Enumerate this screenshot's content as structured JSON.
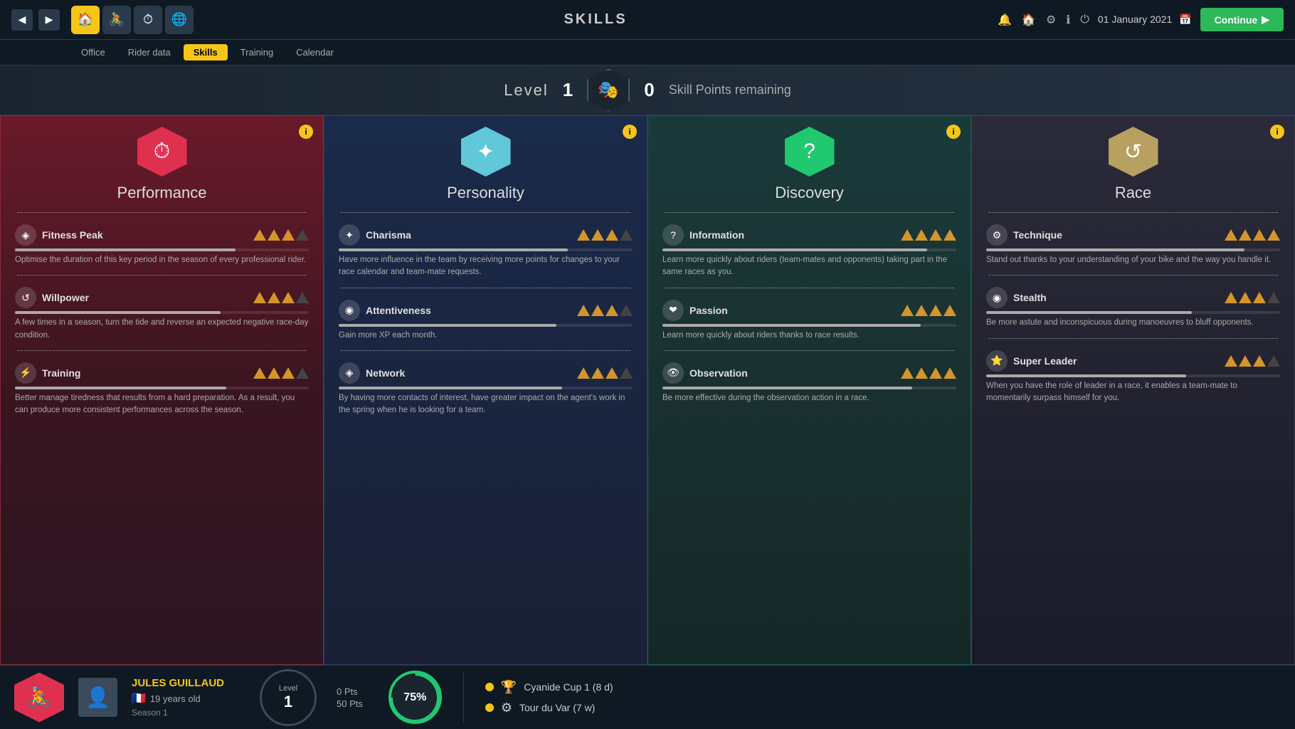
{
  "topBar": {
    "title": "SKILLS",
    "date": "01 January 2021",
    "continueLabel": "Continue"
  },
  "subNav": {
    "tabs": [
      "Office",
      "Rider data",
      "Skills",
      "Training",
      "Calendar"
    ],
    "activeTab": "Skills"
  },
  "levelBar": {
    "levelLabel": "Level",
    "levelNum": "1",
    "skillPointsNum": "0",
    "skillPointsLabel": "Skill Points remaining"
  },
  "cards": [
    {
      "id": "performance",
      "title": "Performance",
      "iconColor": "red",
      "iconSymbol": "⏱",
      "skills": [
        {
          "name": "Fitness Peak",
          "stars": 3,
          "maxStars": 4,
          "barPct": 75,
          "desc": "Optimise the duration of this key period in the season of every professional rider."
        },
        {
          "name": "Willpower",
          "stars": 3,
          "maxStars": 4,
          "barPct": 70,
          "desc": "A few times in a season, turn the tide and reverse an expected negative race-day condition."
        },
        {
          "name": "Training",
          "stars": 3,
          "maxStars": 4,
          "barPct": 72,
          "desc": "Better manage tiredness that results from a hard preparation. As a result, you can produce more consistent performances across the season."
        }
      ]
    },
    {
      "id": "personality",
      "title": "Personality",
      "iconColor": "cyan",
      "iconSymbol": "✦",
      "skills": [
        {
          "name": "Charisma",
          "stars": 3,
          "maxStars": 4,
          "barPct": 78,
          "desc": "Have more influence in the team by receiving more points for changes to your race calendar and team-mate requests."
        },
        {
          "name": "Attentiveness",
          "stars": 3,
          "maxStars": 4,
          "barPct": 74,
          "desc": "Gain more XP each month."
        },
        {
          "name": "Network",
          "stars": 3,
          "maxStars": 4,
          "barPct": 76,
          "desc": "By having more contacts of interest, have greater impact on the agent's work in the spring when he is looking for a team."
        }
      ]
    },
    {
      "id": "discovery",
      "title": "Discovery",
      "iconColor": "green",
      "iconSymbol": "?",
      "skills": [
        {
          "name": "Information",
          "stars": 4,
          "maxStars": 4,
          "barPct": 90,
          "desc": "Learn more quickly about riders (team-mates and opponents) taking part in the same races as you."
        },
        {
          "name": "Passion",
          "stars": 4,
          "maxStars": 4,
          "barPct": 88,
          "desc": "Learn more quickly about riders thanks to race results."
        },
        {
          "name": "Observation",
          "stars": 4,
          "maxStars": 4,
          "barPct": 85,
          "desc": "Be more effective during the observation action in a race."
        }
      ]
    },
    {
      "id": "race",
      "title": "Race",
      "iconColor": "tan",
      "iconSymbol": "↺",
      "skills": [
        {
          "name": "Technique",
          "stars": 4,
          "maxStars": 4,
          "barPct": 88,
          "desc": "Stand out thanks to your understanding of your bike and the way you handle it."
        },
        {
          "name": "Stealth",
          "stars": 3,
          "maxStars": 4,
          "barPct": 70,
          "desc": "Be more astute and inconspicuous during manoeuvres to bluff opponents."
        },
        {
          "name": "Super Leader",
          "stars": 3,
          "maxStars": 4,
          "barPct": 68,
          "desc": "When you have the role of leader in a race, it enables a team-mate to momentarily surpass himself for you."
        }
      ]
    }
  ],
  "bottomBar": {
    "riderName": "JULES GUILLAUD",
    "riderAge": "19 years old",
    "season": "Season 1",
    "levelLabel": "Level",
    "levelNum": "1",
    "ptsLabel": "0 Pts",
    "totalPts": "50 Pts",
    "progressPct": "75%",
    "races": [
      {
        "icon": "🏆",
        "name": "Cyanide Cup 1 (8 d)"
      },
      {
        "icon": "⚙",
        "name": "Tour du Var (7 w)"
      }
    ]
  }
}
